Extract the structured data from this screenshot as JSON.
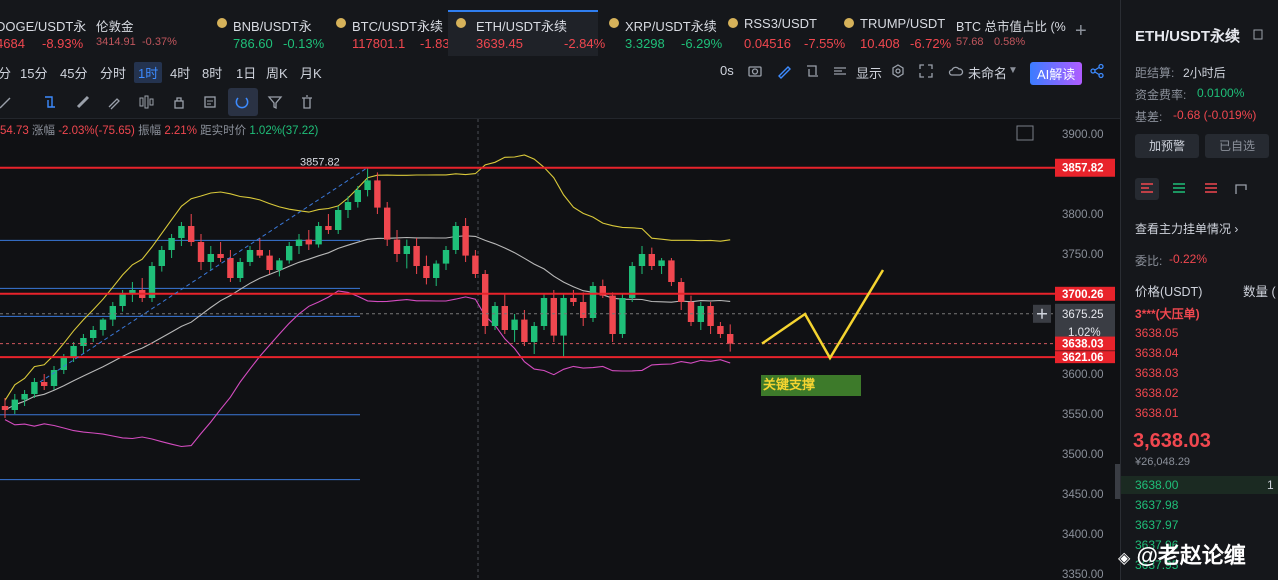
{
  "tabs": [
    {
      "name": "DOGE/USDT永",
      "price": "4684",
      "change": "-8.93%",
      "dir": "down",
      "logo": "coin-dot-icon"
    },
    {
      "name": "伦敦金",
      "price": "3414.91",
      "change": "-0.37%",
      "dir": "down",
      "small": true
    },
    {
      "name": "BNB/USDT永",
      "price": "786.60",
      "change": "-0.13%",
      "dir": "up"
    },
    {
      "name": "BTC/USDT永续",
      "price": "117801.1",
      "change": "-1.83",
      "dir": "down"
    },
    {
      "name": "ETH/USDT永续",
      "price": "3639.45",
      "change": "-2.84%",
      "dir": "down",
      "active": true
    },
    {
      "name": "XRP/USDT永续",
      "price": "3.3298",
      "change": "-6.29%",
      "dir": "up"
    },
    {
      "name": "RSS3/USDT",
      "price": "0.04516",
      "change": "-7.55%",
      "dir": "down"
    },
    {
      "name": "TRUMP/USDT",
      "price": "10.408",
      "change": "-6.72%",
      "dir": "down"
    },
    {
      "name": "BTC 总市值占比 (%",
      "price": "57.68",
      "change": "0.58%",
      "dir": "down",
      "small": true
    }
  ],
  "intervals": [
    "分",
    "15分",
    "45分",
    "分时",
    "1时",
    "4时",
    "8时",
    "1日",
    "周K",
    "月K"
  ],
  "selected_interval": "1时",
  "toolbar_right": {
    "zero": "0s",
    "display": "显示",
    "layout": "未命名",
    "ai": "AI解读"
  },
  "info_line": {
    "p1": "54.73",
    "amp_label": "涨幅",
    "amp": "-2.03%(-75.65)",
    "osc_label": "振幅",
    "osc": "2.21%",
    "dist_label": "距实时价",
    "dist": "1.02%(37.22)"
  },
  "annotations": {
    "high_marker": "3857.82",
    "support_label": "关键支撑"
  },
  "price_axis": {
    "ticks": [
      "3900.00",
      "3850.00",
      "3800.00",
      "3750.00",
      "3700.00",
      "3650.00",
      "3600.00",
      "3550.00",
      "3500.00",
      "3450.00",
      "3400.00",
      "3350.00"
    ],
    "flags": {
      "top": "3857.82",
      "mid": "3700.26",
      "cross": "3675.25",
      "pct": "1.02%",
      "last": "3638.03",
      "low": "3621.06"
    }
  },
  "side": {
    "symbol": "ETH/USDT永续",
    "settle_label": "距结算:",
    "settle": "2小时后",
    "fee_label": "资金费率:",
    "fee": "0.0100%",
    "basis_label": "基差:",
    "basis": "-0.68 (-0.019%)",
    "alert_btn": "加预警",
    "fav_btn": "已自选",
    "depth_link": "查看主力挂单情况",
    "ratio_label": "委比:",
    "ratio": "-0.22%",
    "col_price": "价格(USDT)",
    "col_qty": "数量 (",
    "big_order": "3***(大压单)",
    "asks": [
      "3638.05",
      "3638.04",
      "3638.03",
      "3638.02",
      "3638.01"
    ],
    "last": "3,638.03",
    "last_cny": "¥26,048.29",
    "bids": [
      "3638.00",
      "3637.98",
      "3637.97",
      "3637.96",
      "3637.95"
    ],
    "bid_first_qty": "1"
  },
  "watermark": "@老赵论缠",
  "colors": {
    "up": "#1fbf79",
    "down": "#f0474f",
    "accent": "#2f7ef0",
    "level": "#e8232b",
    "support_box": "#3d7a2a",
    "projection": "#f5d430",
    "bb_upper": "#d9c93a",
    "bb_mid": "#b8b8b8",
    "bb_lower": "#d44cc0"
  },
  "chart_data": {
    "type": "candlestick",
    "interval": "1h",
    "y_range": [
      3350,
      3900
    ],
    "levels": [
      3857.82,
      3700.26,
      3621.06
    ],
    "fib_lines": [
      3767,
      3707,
      3672,
      3549,
      3468
    ],
    "projection": [
      3638,
      3675,
      3620,
      3730
    ],
    "candles": [
      [
        3560,
        3570,
        3545,
        3555
      ],
      [
        3555,
        3575,
        3550,
        3568
      ],
      [
        3568,
        3580,
        3560,
        3575
      ],
      [
        3575,
        3595,
        3570,
        3590
      ],
      [
        3590,
        3600,
        3580,
        3585
      ],
      [
        3585,
        3610,
        3580,
        3605
      ],
      [
        3605,
        3625,
        3600,
        3620
      ],
      [
        3620,
        3640,
        3615,
        3635
      ],
      [
        3635,
        3650,
        3625,
        3645
      ],
      [
        3645,
        3660,
        3640,
        3655
      ],
      [
        3655,
        3670,
        3648,
        3668
      ],
      [
        3668,
        3690,
        3660,
        3685
      ],
      [
        3685,
        3705,
        3678,
        3700
      ],
      [
        3700,
        3715,
        3690,
        3705
      ],
      [
        3705,
        3720,
        3690,
        3695
      ],
      [
        3695,
        3740,
        3690,
        3735
      ],
      [
        3735,
        3760,
        3728,
        3755
      ],
      [
        3755,
        3775,
        3745,
        3770
      ],
      [
        3770,
        3790,
        3760,
        3785
      ],
      [
        3785,
        3800,
        3760,
        3765
      ],
      [
        3765,
        3775,
        3730,
        3740
      ],
      [
        3740,
        3760,
        3730,
        3750
      ],
      [
        3750,
        3765,
        3740,
        3745
      ],
      [
        3745,
        3755,
        3715,
        3720
      ],
      [
        3720,
        3745,
        3715,
        3740
      ],
      [
        3740,
        3760,
        3735,
        3755
      ],
      [
        3755,
        3770,
        3745,
        3748
      ],
      [
        3748,
        3755,
        3725,
        3730
      ],
      [
        3730,
        3745,
        3722,
        3742
      ],
      [
        3742,
        3765,
        3738,
        3760
      ],
      [
        3760,
        3775,
        3750,
        3768
      ],
      [
        3768,
        3780,
        3755,
        3762
      ],
      [
        3762,
        3790,
        3758,
        3785
      ],
      [
        3785,
        3800,
        3775,
        3780
      ],
      [
        3780,
        3810,
        3775,
        3805
      ],
      [
        3805,
        3822,
        3795,
        3815
      ],
      [
        3815,
        3835,
        3808,
        3830
      ],
      [
        3830,
        3858,
        3822,
        3842
      ],
      [
        3842,
        3852,
        3800,
        3808
      ],
      [
        3808,
        3815,
        3760,
        3768
      ],
      [
        3768,
        3780,
        3740,
        3750
      ],
      [
        3750,
        3768,
        3732,
        3760
      ],
      [
        3760,
        3770,
        3725,
        3735
      ],
      [
        3735,
        3748,
        3712,
        3720
      ],
      [
        3720,
        3742,
        3710,
        3738
      ],
      [
        3738,
        3760,
        3730,
        3755
      ],
      [
        3755,
        3790,
        3750,
        3785
      ],
      [
        3785,
        3795,
        3740,
        3748
      ],
      [
        3748,
        3755,
        3720,
        3725
      ],
      [
        3725,
        3730,
        3650,
        3660
      ],
      [
        3660,
        3690,
        3655,
        3685
      ],
      [
        3685,
        3700,
        3650,
        3655
      ],
      [
        3655,
        3675,
        3640,
        3668
      ],
      [
        3668,
        3680,
        3635,
        3640
      ],
      [
        3640,
        3665,
        3625,
        3660
      ],
      [
        3660,
        3700,
        3655,
        3695
      ],
      [
        3695,
        3705,
        3640,
        3648
      ],
      [
        3648,
        3700,
        3622,
        3695
      ],
      [
        3695,
        3705,
        3685,
        3690
      ],
      [
        3690,
        3702,
        3660,
        3670
      ],
      [
        3670,
        3715,
        3665,
        3710
      ],
      [
        3710,
        3718,
        3695,
        3698
      ],
      [
        3698,
        3702,
        3640,
        3650
      ],
      [
        3650,
        3700,
        3645,
        3695
      ],
      [
        3695,
        3740,
        3690,
        3735
      ],
      [
        3735,
        3760,
        3725,
        3750
      ],
      [
        3750,
        3758,
        3730,
        3735
      ],
      [
        3735,
        3745,
        3725,
        3742
      ],
      [
        3742,
        3745,
        3710,
        3715
      ],
      [
        3715,
        3720,
        3680,
        3690
      ],
      [
        3690,
        3698,
        3660,
        3665
      ],
      [
        3665,
        3690,
        3655,
        3685
      ],
      [
        3685,
        3690,
        3650,
        3660
      ],
      [
        3660,
        3665,
        3645,
        3650
      ],
      [
        3650,
        3662,
        3628,
        3638
      ]
    ]
  }
}
